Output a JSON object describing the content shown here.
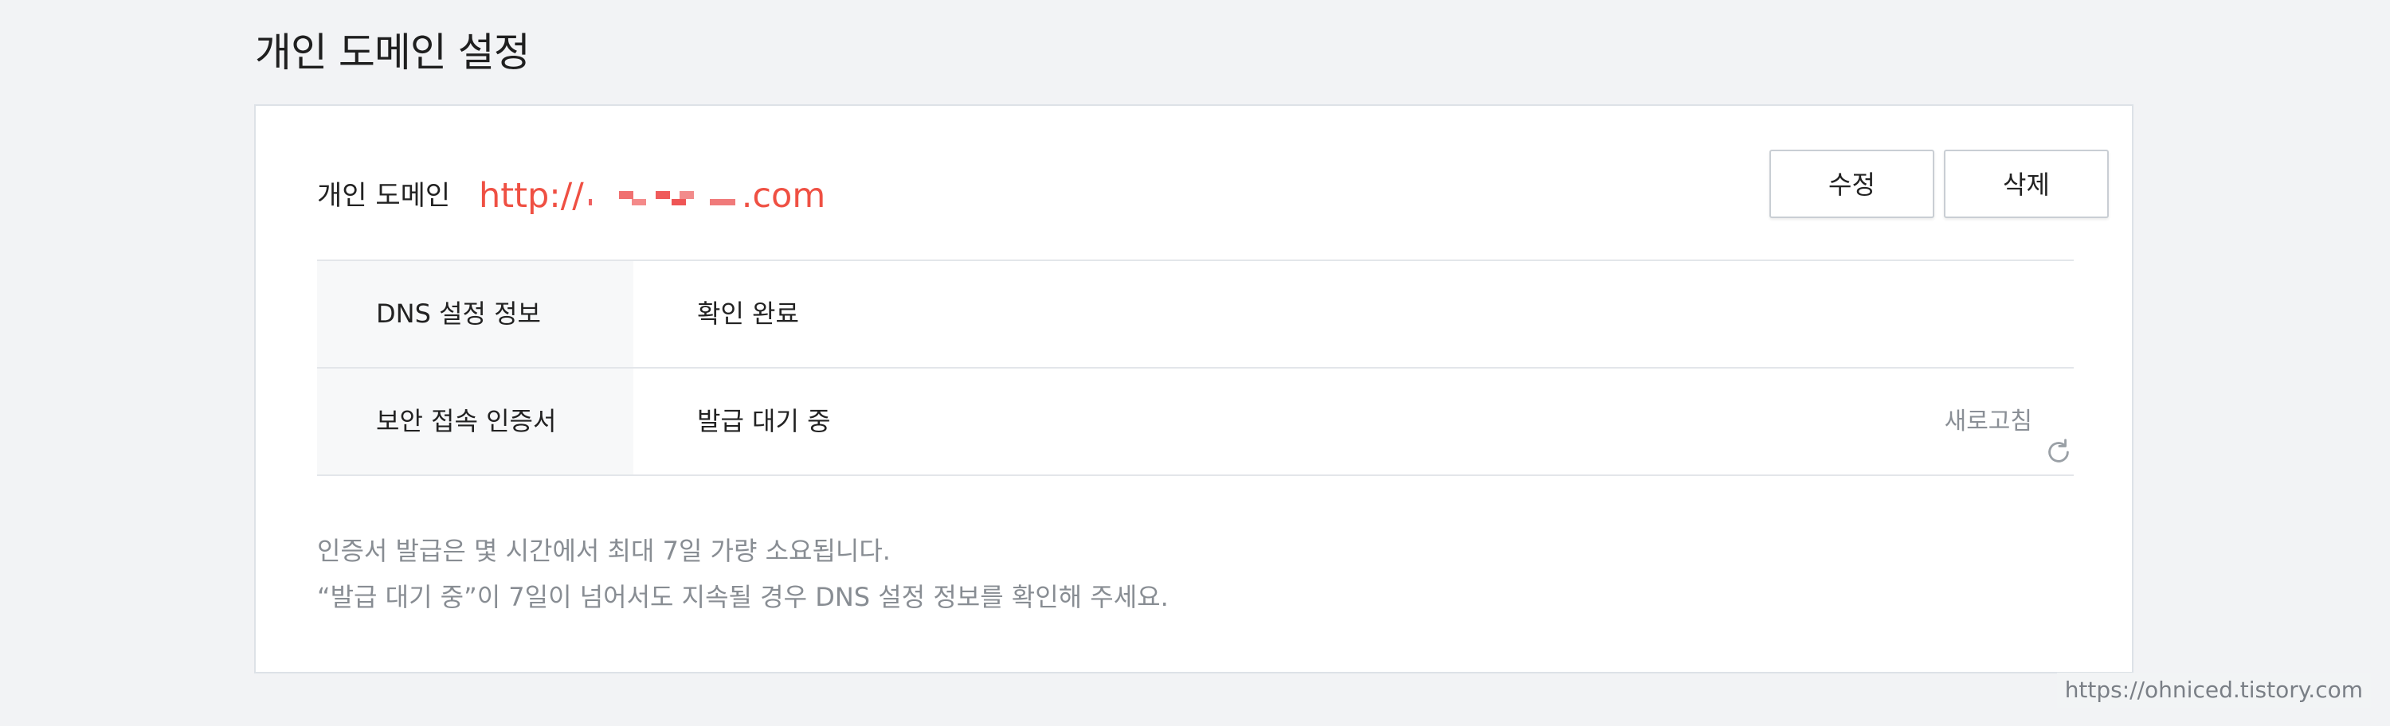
{
  "page": {
    "title": "개인 도메인 설정"
  },
  "domain": {
    "label": "개인 도메인",
    "url_prefix": "http://",
    "url_suffix": ".com",
    "url_color": "#ef5043"
  },
  "actions": {
    "edit_label": "수정",
    "delete_label": "삭제"
  },
  "table": {
    "rows": [
      {
        "label": "DNS 설정 정보",
        "value": "확인 완료"
      },
      {
        "label": "보안 접속 인증서",
        "value": "발급 대기 중"
      }
    ],
    "refresh_label": "새로고침",
    "refresh_icon": "refresh-icon"
  },
  "notes": {
    "line1": "인증서 발급은 몇 시간에서 최대 7일 가량 소요됩니다.",
    "line2": "“발급 대기 중”이 7일이 넘어서도 지속될 경우 DNS 설정 정보를 확인해 주세요."
  },
  "watermark": {
    "text": "https://ohniced.tistory.com"
  },
  "colors": {
    "background": "#f2f3f5",
    "panel_border": "#dde2e7",
    "accent": "#ef5043",
    "muted_text": "#888d93"
  }
}
